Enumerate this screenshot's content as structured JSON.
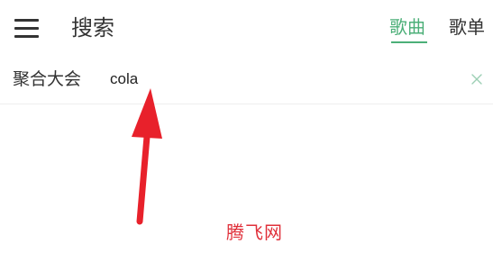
{
  "header": {
    "menu_icon": "hamburger-menu-icon",
    "title": "搜索",
    "tabs": [
      {
        "label": "歌曲",
        "active": true
      },
      {
        "label": "歌单",
        "active": false
      }
    ]
  },
  "search": {
    "source_label": "聚合大会",
    "query": "cola",
    "clear_icon": "close-icon"
  },
  "watermark": "腾飞网",
  "colors": {
    "accent": "#4caf78",
    "text": "#333333",
    "annotation": "#e8212b",
    "watermark": "#e0303a"
  }
}
